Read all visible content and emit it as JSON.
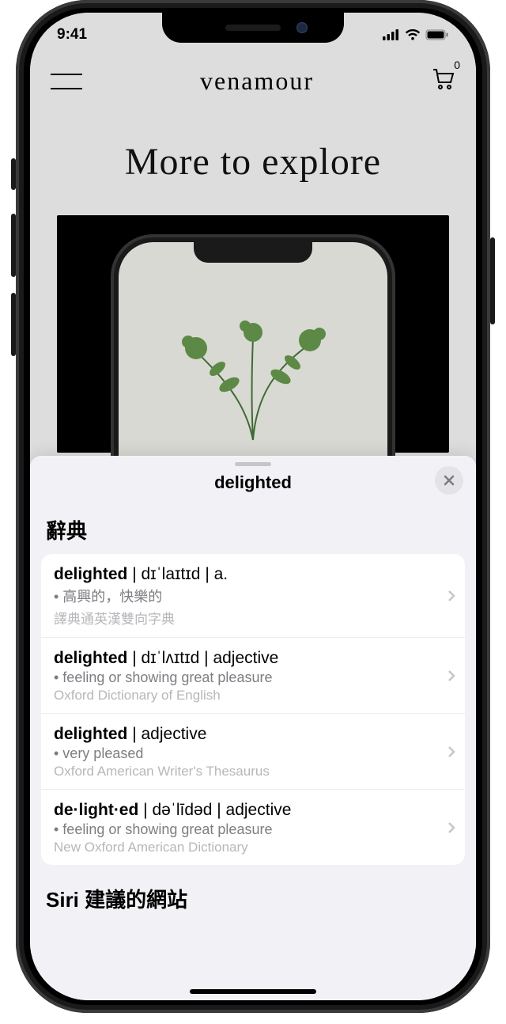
{
  "status": {
    "time": "9:41"
  },
  "appbar": {
    "brand": "venamour",
    "cart_count": "0"
  },
  "page": {
    "headline": "More to explore"
  },
  "sheet": {
    "title": "delighted",
    "section_dict": "辭典",
    "section_siri": "Siri 建議的網站",
    "entries": [
      {
        "term": "delighted",
        "pron": "dɪˈlaɪtɪd",
        "pos": "a.",
        "def": "• 高興的，快樂的",
        "source": "譯典通英漢雙向字典"
      },
      {
        "term": "delighted",
        "pron": "dɪˈlʌɪtɪd",
        "pos": "adjective",
        "def": "• feeling or showing great pleasure",
        "source": "Oxford Dictionary of English"
      },
      {
        "term": "delighted",
        "pron": "",
        "pos": "adjective",
        "def": "• very pleased",
        "source": "Oxford American Writer's Thesaurus"
      },
      {
        "term": "de·light·ed",
        "pron": "dəˈlīdəd",
        "pos": "adjective",
        "def": "• feeling or showing great pleasure",
        "source": "New Oxford American Dictionary"
      }
    ]
  }
}
